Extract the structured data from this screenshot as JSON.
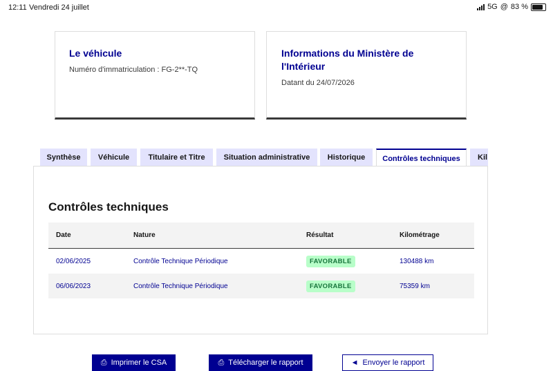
{
  "status_bar": {
    "time": "12:11",
    "date": "Vendredi 24 juillet",
    "network": "5G",
    "battery": "83 %"
  },
  "vehicle_card": {
    "title": "Le véhicule",
    "plate_text": "Numéro d'immatriculation : FG-2**-TQ"
  },
  "ministry_card": {
    "title_line1": "Informations du Ministère de",
    "title_line2": "l'Intérieur",
    "date_text": "Datant du 24/07/2026"
  },
  "tabs": [
    {
      "label": "Synthèse"
    },
    {
      "label": "Véhicule"
    },
    {
      "label": "Titulaire et Titre"
    },
    {
      "label": "Situation administrative"
    },
    {
      "label": "Historique"
    },
    {
      "label": "Contrôles techniques"
    },
    {
      "label": "Kil"
    }
  ],
  "panel": {
    "title": "Contrôles techniques",
    "columns": [
      "Date",
      "Nature",
      "Résultat",
      "Kilométrage"
    ],
    "rows": [
      {
        "date": "02/06/2025",
        "nature": "Contrôle Technique Périodique",
        "result": "FAVORABLE",
        "mileage": "130488 km"
      },
      {
        "date": "06/06/2023",
        "nature": "Contrôle Technique Périodique",
        "result": "FAVORABLE",
        "mileage": "75359 km"
      }
    ]
  },
  "actions": {
    "print_label": "Imprimer le CSA",
    "download_label": "Télécharger le rapport",
    "send_label": "Envoyer le rapport"
  },
  "colors": {
    "primary": "#000091",
    "tab_bg": "#e3e3fd",
    "success_bg": "#b8fec9",
    "success_text": "#18753c"
  }
}
